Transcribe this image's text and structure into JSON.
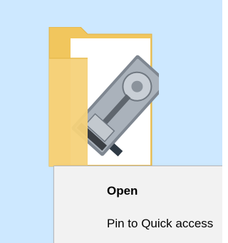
{
  "colors": {
    "selection_background": "#cde8ff",
    "menu_background": "#f2f2f2",
    "folder_yellow": "#f6d27a",
    "menu_border": "#b9b9b9"
  },
  "folder": {
    "icon": "folder-with-hard-drive-thumbnail-icon"
  },
  "context_menu": {
    "items": [
      {
        "label": "Open",
        "default": true
      },
      {
        "label": "Pin to Quick access"
      }
    ]
  }
}
